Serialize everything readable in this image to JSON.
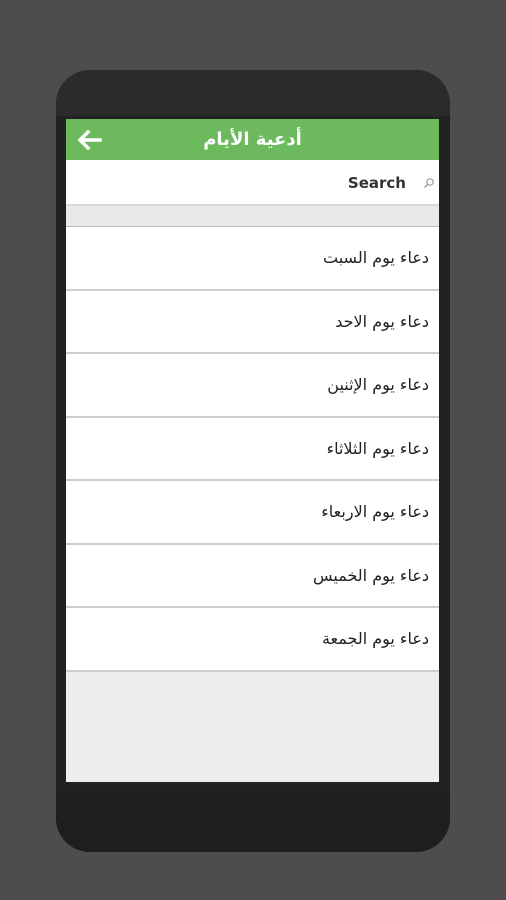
{
  "appbar": {
    "title": "أدعية الأيام",
    "back_icon": "arrow-left-icon",
    "color": "#6dba5e"
  },
  "search": {
    "placeholder": "Search",
    "icon": "search-icon"
  },
  "list": {
    "items": [
      {
        "label": "دعاء يوم السبت"
      },
      {
        "label": "دعاء يوم الاحد"
      },
      {
        "label": "دعاء يوم الإثنين"
      },
      {
        "label": "دعاء يوم الثلاثاء"
      },
      {
        "label": "دعاء يوم الاربعاء"
      },
      {
        "label": "دعاء يوم الخميس"
      },
      {
        "label": "دعاء يوم الجمعة"
      }
    ]
  }
}
